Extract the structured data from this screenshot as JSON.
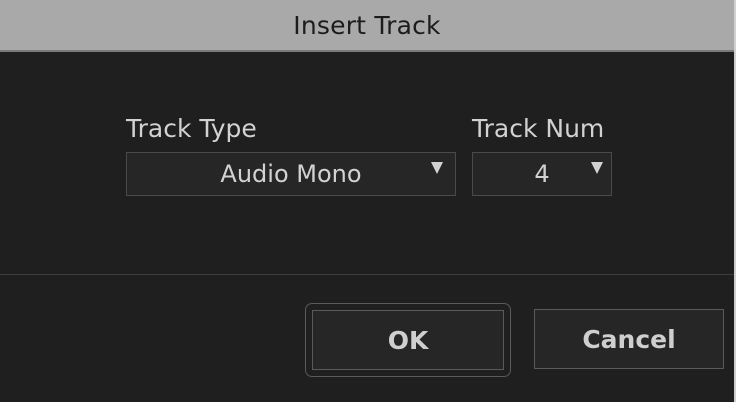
{
  "dialog": {
    "title": "Insert Track"
  },
  "track_type": {
    "label": "Track Type",
    "selected": "Audio Mono",
    "icon": "triangle-down-icon"
  },
  "track_num": {
    "label": "Track Num",
    "selected": "4",
    "icon": "triangle-down-icon"
  },
  "buttons": {
    "ok_label": "OK",
    "cancel_label": "Cancel"
  },
  "colors": {
    "titlebar": "#a9a9a9",
    "background": "#1f1f1f",
    "text": "#d2d2d2"
  }
}
